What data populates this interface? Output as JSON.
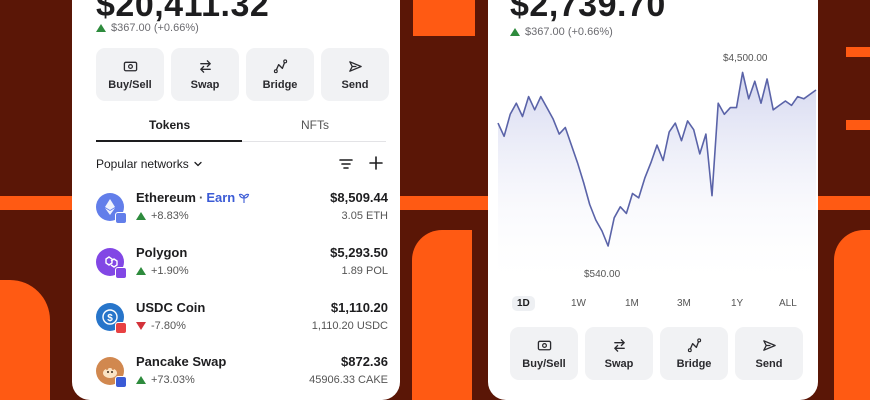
{
  "colors": {
    "background": "#5a1606",
    "accent_orange": "#ff5a13",
    "positive": "#2e8b3d",
    "negative": "#d3323a",
    "chart_line": "#5a63a8"
  },
  "left": {
    "balance": "$20,411.32",
    "delta": "$367.00 (+0.66%)",
    "actions": [
      {
        "label": "Buy/Sell",
        "icon": "cash-icon"
      },
      {
        "label": "Swap",
        "icon": "swap-arrows-icon"
      },
      {
        "label": "Bridge",
        "icon": "bridge-icon"
      },
      {
        "label": "Send",
        "icon": "send-icon"
      }
    ],
    "tabs": [
      {
        "label": "Tokens",
        "active": true
      },
      {
        "label": "NFTs",
        "active": false
      }
    ],
    "network_filter": "Popular networks",
    "tokens": [
      {
        "name": "Ethereum",
        "earn": "Earn",
        "change": "+8.83%",
        "direction": "up",
        "value": "$8,509.44",
        "amount": "3.05 ETH",
        "icon_color": "#627eea",
        "badge_color": "#627eea"
      },
      {
        "name": "Polygon",
        "earn": "",
        "change": "+1.90%",
        "direction": "up",
        "value": "$5,293.50",
        "amount": "1.89 POL",
        "icon_color": "#8247e5",
        "badge_color": "#8247e5"
      },
      {
        "name": "USDC Coin",
        "earn": "",
        "change": "-7.80%",
        "direction": "down",
        "value": "$1,110.20",
        "amount": "1,110.20 USDC",
        "icon_color": "#2775ca",
        "badge_color": "#e84142"
      },
      {
        "name": "Pancake Swap",
        "earn": "",
        "change": "+73.03%",
        "direction": "up",
        "value": "$872.36",
        "amount": "45906.33 CAKE",
        "icon_color": "#1fc7d4",
        "badge_color": "#3b5bd6"
      }
    ]
  },
  "right": {
    "balance": "$2,739.70",
    "delta": "$367.00 (+0.66%)",
    "chart_high_label": "$4,500.00",
    "chart_low_label": "$540.00",
    "ranges": [
      {
        "label": "1D",
        "active": true
      },
      {
        "label": "1W",
        "active": false
      },
      {
        "label": "1M",
        "active": false
      },
      {
        "label": "3M",
        "active": false
      },
      {
        "label": "1Y",
        "active": false
      },
      {
        "label": "ALL",
        "active": false
      }
    ],
    "actions": [
      {
        "label": "Buy/Sell",
        "icon": "cash-icon"
      },
      {
        "label": "Swap",
        "icon": "swap-arrows-icon"
      },
      {
        "label": "Bridge",
        "icon": "bridge-icon"
      },
      {
        "label": "Send",
        "icon": "send-icon"
      }
    ]
  },
  "chart_data": {
    "type": "area",
    "title": "",
    "xlabel": "",
    "ylabel": "",
    "annotations": [
      "$4,500.00",
      "$540.00"
    ],
    "x": [
      0,
      1,
      2,
      3,
      4,
      5,
      6,
      7,
      8,
      9,
      10,
      11,
      12,
      13,
      14,
      15,
      16,
      17,
      18,
      19,
      20,
      21,
      22,
      23,
      24,
      25,
      26,
      27,
      28,
      29,
      30,
      31,
      32,
      33,
      34,
      35,
      36,
      37,
      38,
      39,
      40,
      41,
      42,
      43,
      44,
      45,
      46,
      47,
      48,
      49,
      50,
      51,
      52
    ],
    "series": [
      {
        "values": [
          3350,
          3050,
          3550,
          3800,
          3500,
          3950,
          3650,
          3950,
          3700,
          3450,
          3100,
          3250,
          2850,
          2450,
          2000,
          1500,
          1150,
          900,
          560,
          1200,
          1450,
          1300,
          1750,
          1650,
          2100,
          2450,
          2850,
          2500,
          3150,
          3350,
          2950,
          3400,
          3200,
          2650,
          3100,
          1700,
          3800,
          3550,
          3700,
          3700,
          4500,
          3900,
          4300,
          3800,
          4350,
          3650,
          3750,
          3850,
          3750,
          3950,
          3900,
          4000,
          4100
        ]
      }
    ],
    "ylim": [
      400,
      4600
    ],
    "grid": false
  }
}
